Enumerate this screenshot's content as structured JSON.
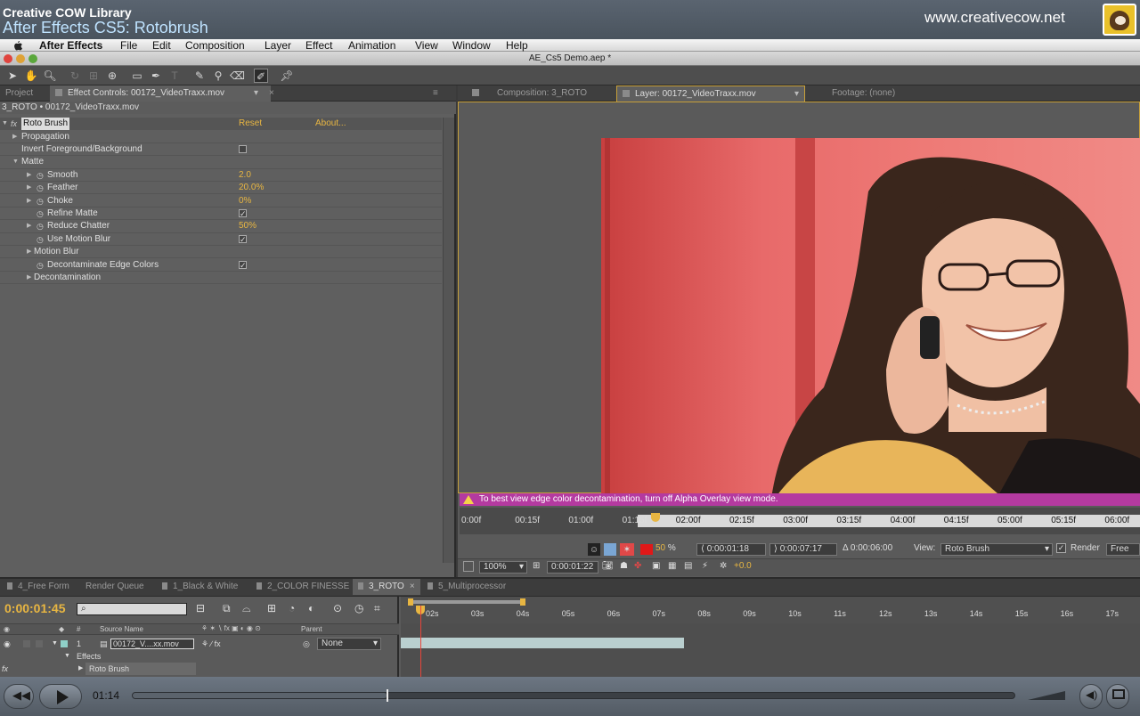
{
  "video_header": {
    "line1": "Creative COW Library",
    "line2": "After Effects CS5: Rotobrush",
    "site": "www.creativecow.net"
  },
  "menubar": {
    "app": "After Effects",
    "items": [
      "File",
      "Edit",
      "Composition",
      "Layer",
      "Effect",
      "Animation",
      "View",
      "Window",
      "Help"
    ]
  },
  "window": {
    "title": "AE_Cs5 Demo.aep *"
  },
  "left_panel": {
    "tabs": [
      "Project",
      "Effect Controls: 00172_VideoTraxx.mov"
    ],
    "subheader": "3_ROTO • 00172_VideoTraxx.mov",
    "effect": {
      "name": "Roto Brush",
      "reset": "Reset",
      "about": "About..."
    },
    "properties": [
      {
        "name": "Propagation",
        "value": ""
      },
      {
        "name": "Invert Foreground/Background",
        "value": ""
      },
      {
        "name": "Matte",
        "value": ""
      },
      {
        "name": "Smooth",
        "value": "2.0"
      },
      {
        "name": "Feather",
        "value": "20.0%"
      },
      {
        "name": "Choke",
        "value": "0%"
      },
      {
        "name": "Refine Matte",
        "value": ""
      },
      {
        "name": "Reduce Chatter",
        "value": "50%"
      },
      {
        "name": "Use Motion Blur",
        "value": ""
      },
      {
        "name": "Motion Blur",
        "value": ""
      },
      {
        "name": "Decontaminate Edge Colors",
        "value": ""
      },
      {
        "name": "Decontamination",
        "value": ""
      }
    ]
  },
  "viewer": {
    "tabs": [
      "Composition: 3_ROTO",
      "Layer: 00172_VideoTraxx.mov",
      "Footage: (none)"
    ],
    "warning": "To best view edge color decontamination, turn off Alpha Overlay view mode.",
    "ruler_ticks": [
      "0:00f",
      "00:15f",
      "01:00f",
      "01:15f",
      "02:00f",
      "02:15f",
      "03:00f",
      "03:15f",
      "04:00f",
      "04:15f",
      "05:00f",
      "05:15f",
      "06:00f"
    ],
    "overlay_percent": "50",
    "percent_sign": "%",
    "in_point": "0:00:01:18",
    "out_point": "0:00:07:17",
    "duration": "Δ 0:00:06:00",
    "view_label": "View:",
    "view_value": "Roto Brush",
    "render_label": "Render",
    "free_label": "Free",
    "zoom": "100%",
    "current_time": "0:00:01:22",
    "exposure": "+0.0",
    "colors": {
      "warning_bar": "#b43aa0",
      "accent": "#e8b642"
    }
  },
  "timeline": {
    "tabs": [
      "4_Free Form",
      "Render Queue",
      "1_Black & White",
      "2_COLOR FINESSE",
      "3_ROTO",
      "5_Multiprocessor"
    ],
    "timecode": "0:00:01:45",
    "headers": {
      "num": "#",
      "source_name": "Source Name",
      "parent": "Parent"
    },
    "ticks": [
      "02s",
      "03s",
      "04s",
      "05s",
      "06s",
      "07s",
      "08s",
      "09s",
      "10s",
      "11s",
      "12s",
      "13s",
      "14s",
      "15s",
      "16s",
      "17s"
    ],
    "layer": {
      "num": "1",
      "name": "00172_V....xx.mov",
      "parent": "None"
    },
    "effects_label": "Effects",
    "roto_label": "Roto Brush"
  },
  "player": {
    "time": "01:14",
    "progress": 0.288
  }
}
